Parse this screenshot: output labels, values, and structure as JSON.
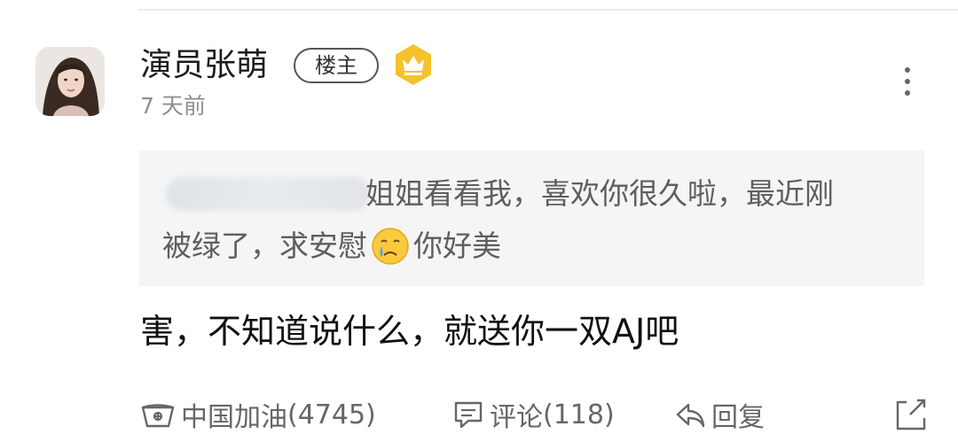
{
  "post": {
    "username": "演员张萌",
    "op_badge": "楼主",
    "badge_icon": "crown-icon",
    "timestamp": "7 天前",
    "quote": {
      "line1": "姐姐看看我，喜欢你很久啦，最近刚",
      "line2_a": "被绿了，求安慰",
      "line2_emoji": "crying-face-emoji",
      "line2_b": "你好美"
    },
    "reply": "害，不知道说什么，就送你一双AJ吧"
  },
  "actions": {
    "like_label": "中国加油",
    "like_count": "(4745)",
    "comment_label": "评论",
    "comment_count": "(118)",
    "reply_label": "回复"
  },
  "colors": {
    "badge_gold": "#f5c12e",
    "quote_bg": "#f5f5f5",
    "secondary_text": "#8e8e8e"
  }
}
